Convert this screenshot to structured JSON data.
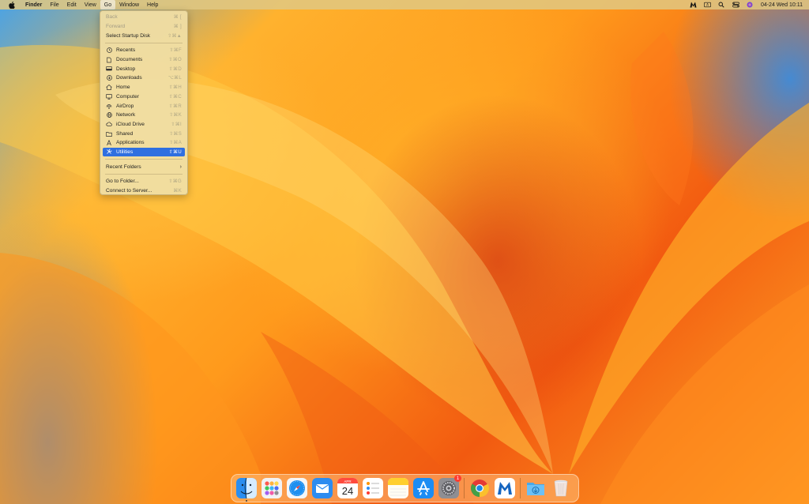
{
  "menubar": {
    "app_name": "Finder",
    "menus": [
      "File",
      "Edit",
      "View",
      "Go",
      "Window",
      "Help"
    ],
    "active_menu": "Go",
    "status": {
      "datetime": "04-24 Wed  10:11"
    }
  },
  "go_menu": {
    "items": [
      {
        "label": "Back",
        "shortcut": "⌘ [",
        "disabled": true
      },
      {
        "label": "Forward",
        "shortcut": "⌘ ]",
        "disabled": true
      },
      {
        "label": "Select Startup Disk",
        "shortcut": "⇧⌘▲",
        "disabled": false
      },
      {
        "label": "Recents",
        "shortcut": "⇧⌘F",
        "icon": "clock-icon"
      },
      {
        "label": "Documents",
        "shortcut": "⇧⌘O",
        "icon": "document-icon"
      },
      {
        "label": "Desktop",
        "shortcut": "⇧⌘D",
        "icon": "desktop-icon"
      },
      {
        "label": "Downloads",
        "shortcut": "⌥⌘L",
        "icon": "download-icon"
      },
      {
        "label": "Home",
        "shortcut": "⇧⌘H",
        "icon": "home-icon"
      },
      {
        "label": "Computer",
        "shortcut": "⇧⌘C",
        "icon": "computer-icon"
      },
      {
        "label": "AirDrop",
        "shortcut": "⇧⌘R",
        "icon": "airdrop-icon"
      },
      {
        "label": "Network",
        "shortcut": "⇧⌘K",
        "icon": "network-icon"
      },
      {
        "label": "iCloud Drive",
        "shortcut": "⇧⌘I",
        "icon": "cloud-icon"
      },
      {
        "label": "Shared",
        "shortcut": "⇧⌘S",
        "icon": "shared-folder-icon"
      },
      {
        "label": "Applications",
        "shortcut": "⇧⌘A",
        "icon": "applications-icon"
      },
      {
        "label": "Utilities",
        "shortcut": "⇧⌘U",
        "icon": "utilities-icon",
        "selected": true
      },
      {
        "label": "Recent Folders"
      },
      {
        "label": "Go to Folder...",
        "shortcut": "⇧⌘G"
      },
      {
        "label": "Connect to Server...",
        "shortcut": "⌘K"
      }
    ]
  },
  "dock": {
    "calendar": {
      "month": "APR",
      "day": "24"
    },
    "settings_badge": "1"
  },
  "colors": {
    "menu_highlight": "#2f6fe0",
    "badge": "#ff3b30"
  }
}
